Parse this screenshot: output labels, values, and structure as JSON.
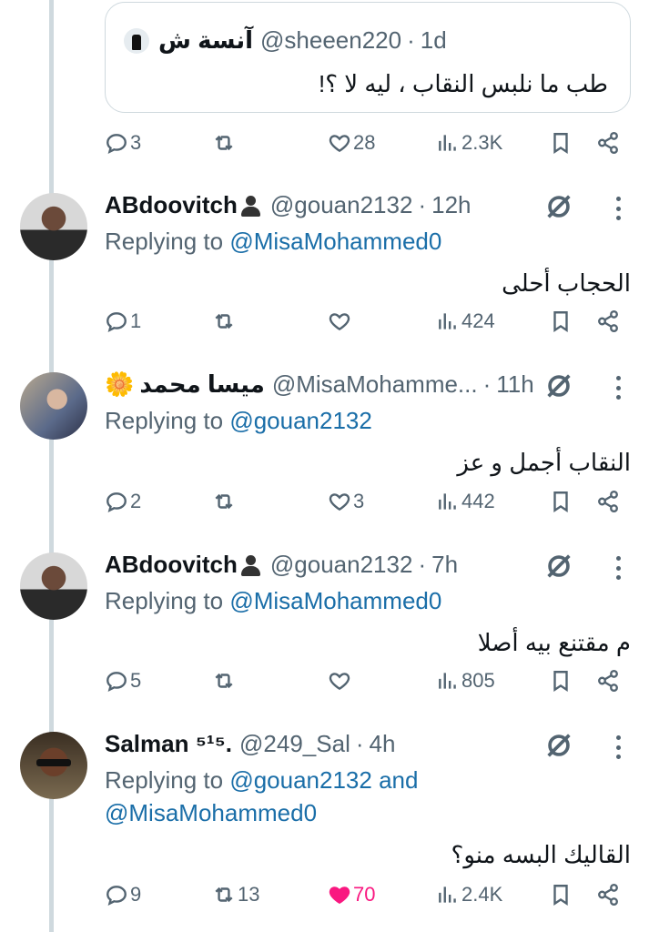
{
  "quoted": {
    "name": "آنسة ش",
    "handle": "@sheeen220",
    "time": "1d",
    "text": "طب ما نلبس النقاب ، ليه لا ؟!"
  },
  "quote_actions": {
    "replies": "3",
    "retweets": "",
    "likes": "28",
    "views": "2.3K"
  },
  "tweets": [
    {
      "name": "ABdoovitch",
      "handle": "@gouan2132",
      "time": "12h",
      "replying_prefix": "Replying to ",
      "replying_to": "@MisaMohammed0",
      "replying_to_2": "",
      "text": "الحجاب أحلى",
      "replies": "1",
      "retweets": "",
      "likes": "",
      "views": "424"
    },
    {
      "name": "ميسا محمد",
      "handle": "@MisaMohamme...",
      "time": "11h",
      "replying_prefix": "Replying to ",
      "replying_to": "@gouan2132",
      "replying_to_2": "",
      "text": "النقاب أجمل و عز",
      "replies": "2",
      "retweets": "",
      "likes": "3",
      "views": "442"
    },
    {
      "name": "ABdoovitch",
      "handle": "@gouan2132",
      "time": "7h",
      "replying_prefix": "Replying to ",
      "replying_to": "@MisaMohammed0",
      "replying_to_2": "",
      "text": "م مقتنع بيه أصلا",
      "replies": "5",
      "retweets": "",
      "likes": "",
      "views": "805"
    },
    {
      "name": "Salman ⁵¹⁵.",
      "handle": "@249_Sal",
      "time": "4h",
      "replying_prefix": "Replying to ",
      "replying_to": "@gouan2132 and",
      "replying_to_2": "@MisaMohammed0",
      "text": "القاليك البسه منو؟",
      "replies": "9",
      "retweets": "13",
      "likes": "70",
      "views": "2.4K"
    }
  ],
  "icons": {
    "reply": "reply-icon",
    "retweet": "retweet-icon",
    "like": "heart-icon",
    "views": "views-icon",
    "bookmark": "bookmark-icon",
    "share": "share-icon",
    "grok": "grok-icon",
    "more": "more-icon"
  },
  "colors": {
    "text": "#0f1419",
    "muted": "#536471",
    "link": "#1a6ea8",
    "like_active": "#f91880",
    "line": "#cfd9de"
  }
}
